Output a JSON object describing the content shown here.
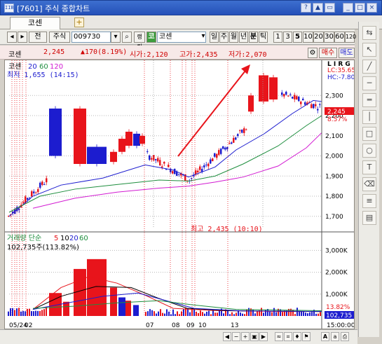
{
  "window": {
    "title": "[7601] 주식 종합차트",
    "app_icon": "app-icon",
    "controls": [
      "?",
      "▲",
      "□",
      "_",
      "□",
      "×"
    ]
  },
  "tabs": [
    {
      "label": "코센"
    }
  ],
  "toolbar": {
    "market_label": "전",
    "category_label": "주식",
    "code_value": "009730",
    "stock_badge": "코",
    "stock_name": "코센",
    "mode_label": "랭킹",
    "periods": [
      "일",
      "주",
      "월",
      "년",
      "분",
      "틱"
    ],
    "intervals": [
      "1",
      "3",
      "5",
      "10",
      "20",
      "30",
      "60",
      "120"
    ],
    "active_interval": "5"
  },
  "infobar": {
    "name": "코센",
    "price": "2,245",
    "change": "▲170(8.19%)",
    "open": "시가:2,120",
    "high": "고가:2,435",
    "low": "저가:2,070",
    "buy_label": "매수",
    "sell_label": "매도"
  },
  "chart_labels": {
    "price_legend_name": "코센",
    "ma_periods": [
      "20",
      "60",
      "120"
    ],
    "min_note": "최저 1,655 (14:15)",
    "max_note": "최고 2,435 (10:10)",
    "lc_label": "LC:35.65",
    "hc_label": "HC:-7.80",
    "current_price_tag": "2,245",
    "pct_tag": "8.57%",
    "volume_legend": "거래량 단순",
    "volume_ma_periods": [
      "5",
      "10",
      "20",
      "60"
    ],
    "volume_value": "102,735주(113.82%)",
    "volume_pct_tag": "13.82%",
    "volume_current_tag": "102,735",
    "logscale_letters": "L I R G"
  },
  "colors": {
    "up": "#e8141b",
    "down": "#1c1ccf",
    "ma20": "#1c1ccf",
    "ma60": "#1e8e3e",
    "ma120": "#d21ad2",
    "title_bar": "#2f5fc6"
  },
  "chart_data": {
    "type": "candlestick",
    "price_axis": {
      "ticks": [
        1700,
        1800,
        1900,
        2000,
        2100,
        2200,
        2300
      ],
      "range": [
        1640,
        2440
      ]
    },
    "volume_axis": {
      "ticks": [
        "1,000K",
        "2,000K",
        "3,000K"
      ],
      "range": [
        0,
        3300000
      ]
    },
    "x_ticks": [
      "05/24",
      "02",
      "07",
      "08",
      "09",
      "10",
      "13",
      "15:00:00"
    ],
    "max_price": 2435,
    "min_price": 1655,
    "last_price": 2245
  }
}
